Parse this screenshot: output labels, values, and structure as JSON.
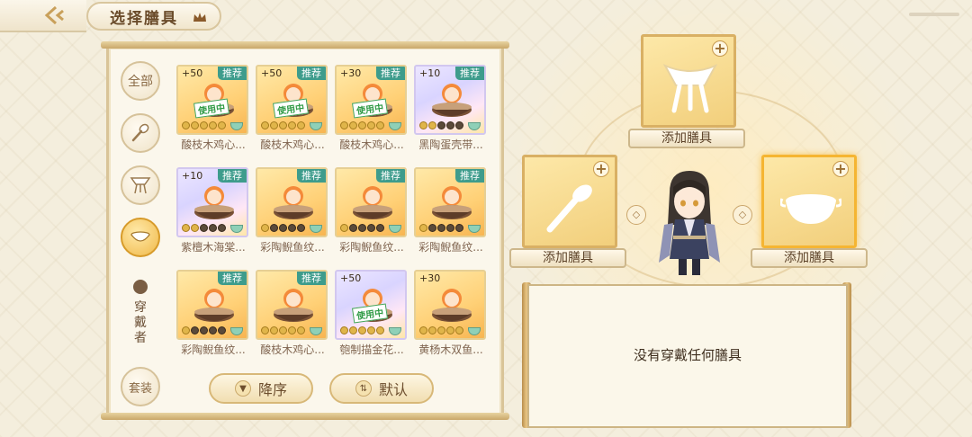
{
  "header": {
    "title": "选择膳具"
  },
  "sidebar": {
    "all_label": "全部",
    "worn_label": "穿戴者",
    "suit_label": "套装"
  },
  "grid": {
    "items": [
      {
        "name": "酸枝木鸡心...",
        "bonus": "+50",
        "badge": "推荐",
        "status": "使用中",
        "theme": "orange",
        "dark_stars": 0
      },
      {
        "name": "酸枝木鸡心...",
        "bonus": "+50",
        "badge": "推荐",
        "status": "使用中",
        "theme": "orange",
        "dark_stars": 0
      },
      {
        "name": "酸枝木鸡心...",
        "bonus": "+30",
        "badge": "推荐",
        "status": "使用中",
        "theme": "orange",
        "dark_stars": 0
      },
      {
        "name": "黑陶蛋壳带...",
        "bonus": "+10",
        "badge": "推荐",
        "status": "",
        "theme": "purple",
        "dark_stars": 3
      },
      {
        "name": "紫檀木海棠...",
        "bonus": "+10",
        "badge": "推荐",
        "status": "",
        "theme": "purple",
        "dark_stars": 3
      },
      {
        "name": "彩陶鲵鱼纹...",
        "bonus": "",
        "badge": "推荐",
        "status": "",
        "theme": "orange",
        "dark_stars": 4
      },
      {
        "name": "彩陶鲵鱼纹...",
        "bonus": "",
        "badge": "推荐",
        "status": "",
        "theme": "orange",
        "dark_stars": 4
      },
      {
        "name": "彩陶鲵鱼纹...",
        "bonus": "",
        "badge": "推荐",
        "status": "",
        "theme": "orange",
        "dark_stars": 4
      },
      {
        "name": "彩陶鲵鱼纹...",
        "bonus": "",
        "badge": "推荐",
        "status": "",
        "theme": "orange",
        "dark_stars": 4
      },
      {
        "name": "酸枝木鸡心...",
        "bonus": "",
        "badge": "推荐",
        "status": "",
        "theme": "orange",
        "dark_stars": 0
      },
      {
        "name": "匏制描金花...",
        "bonus": "+50",
        "badge": "",
        "status": "使用中",
        "theme": "purple",
        "dark_stars": 0
      },
      {
        "name": "黄杨木双鱼...",
        "bonus": "+30",
        "badge": "",
        "status": "",
        "theme": "orange",
        "dark_stars": 0
      }
    ]
  },
  "sort": {
    "order_label": "降序",
    "default_label": "默认"
  },
  "slots": {
    "top_label": "添加膳具",
    "left_label": "添加膳具",
    "right_label": "添加膳具"
  },
  "info": {
    "empty_text": "没有穿戴任何膳具"
  },
  "colors": {
    "accent": "#f0b94a",
    "badge": "#3e9c8c",
    "in_use": "#2f9a45"
  }
}
